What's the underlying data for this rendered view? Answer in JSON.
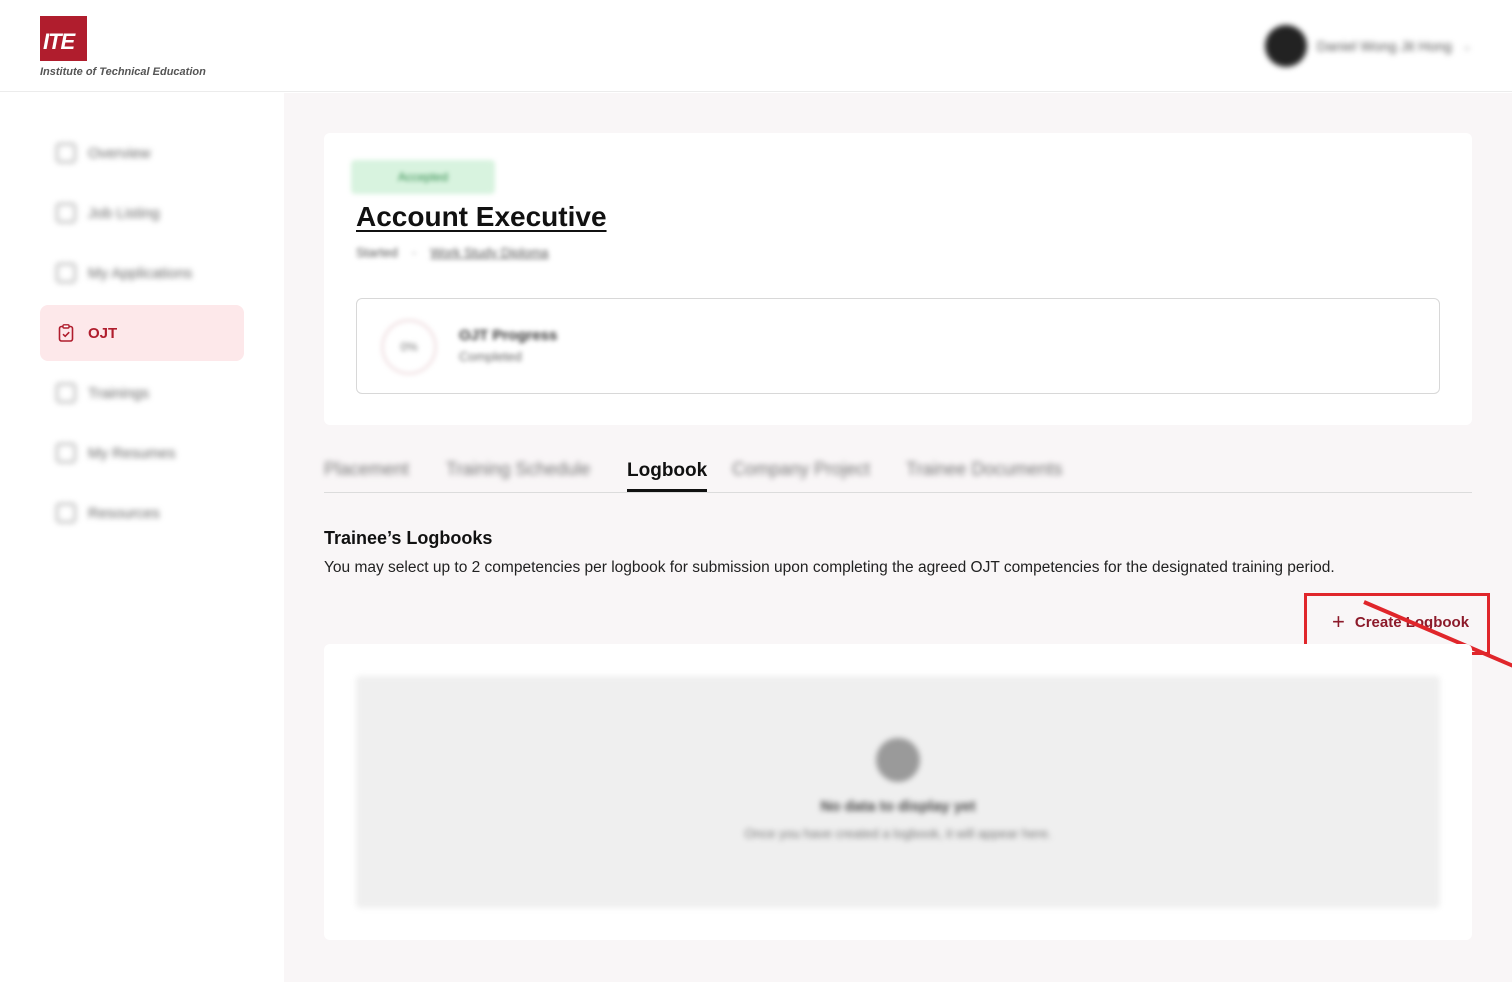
{
  "header": {
    "logo_mark": "ITE",
    "logo_text": "Institute of Technical Education",
    "user_name": "Daniel Wong Jit Hong",
    "user_caret": "⌄"
  },
  "sidebar": {
    "items": [
      {
        "label": "Overview",
        "icon": "home-icon"
      },
      {
        "label": "Job Listing",
        "icon": "briefcase-icon"
      },
      {
        "label": "My Applications",
        "icon": "document-icon"
      },
      {
        "label": "OJT",
        "icon": "clipboard-check-icon",
        "active": true
      },
      {
        "label": "Trainings",
        "icon": "book-icon"
      },
      {
        "label": "My Resumes",
        "icon": "file-icon"
      },
      {
        "label": "Resources",
        "icon": "folder-icon"
      }
    ]
  },
  "job": {
    "status": "Accepted",
    "title": "Account Executive",
    "period": "Started",
    "company": "Work Study Diploma"
  },
  "progress": {
    "value": "0%",
    "title": "OJT Progress",
    "subtitle": "Completed"
  },
  "tabs": [
    {
      "label": "Placement",
      "active": false
    },
    {
      "label": "Training Schedule",
      "active": false
    },
    {
      "label": "Logbook",
      "active": true
    },
    {
      "label": "Company Project",
      "active": false
    },
    {
      "label": "Trainee Documents",
      "active": false
    }
  ],
  "logbooks": {
    "title": "Trainee’s Logbooks",
    "description": "You may select up to 2 competencies per logbook for submission upon completing the agreed OJT competencies for the designated training period.",
    "create_label": "Create Logbook",
    "create_icon": "plus-icon",
    "empty_title": "No data to display yet",
    "empty_subtitle": "Once you have created a logbook, it will appear here."
  },
  "colors": {
    "brand": "#b01d2d",
    "accent_text": "#8c1a2a",
    "annotation": "#e0262b",
    "active_nav_bg": "#fde8ea"
  }
}
